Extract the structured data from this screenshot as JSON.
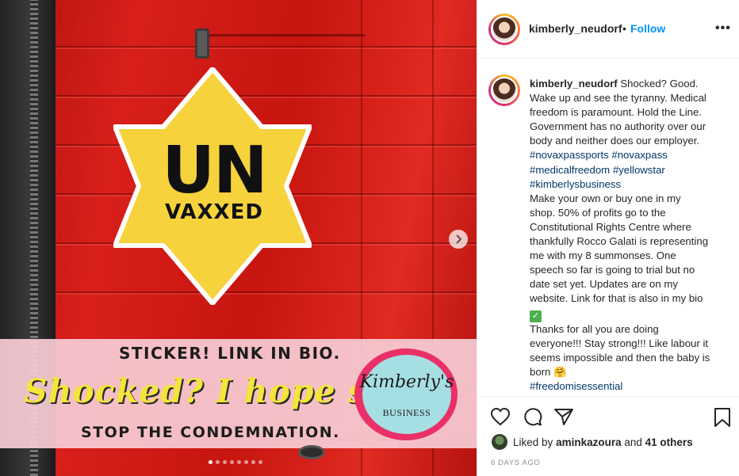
{
  "media": {
    "star_line1": "UN",
    "star_line2": "VAXXED",
    "banner_top": "STICKER!  LINK IN BIO.",
    "banner_script": "Shocked? I hope so.",
    "banner_bottom": "STOP THE CONDEMNATION.",
    "logo_script": "Kimberly's",
    "logo_sub": "BUSINESS",
    "carousel_total": 8,
    "carousel_active": 1,
    "colors": {
      "star": "#f6d33c",
      "banner": "#f7cdd6",
      "jacket": "#d81f1b"
    }
  },
  "header": {
    "username": "kimberly_neudorf",
    "separator": "•",
    "follow_label": "Follow",
    "more_label": "•••"
  },
  "caption": {
    "username": "kimberly_neudorf",
    "lines": [
      "Shocked? Good.",
      "Wake up and see the tyranny. Medical",
      "freedom is paramount. Hold the Line.",
      "Government has no authority over our",
      "body and neither does our employer."
    ],
    "tags_1": [
      "#novaxpassports",
      "#novaxpass"
    ],
    "tags_2": [
      "#medicalfreedom",
      "#yellowstar"
    ],
    "tags_3": [
      "#kimberlysbusiness"
    ],
    "body_lines": [
      "Make your own or buy one in my",
      "shop. 50% of profits go to the",
      "Constitutional Rights Centre where",
      "thankfully Rocco Galati is representing",
      "me with my 8 summonses. One",
      "speech so far is going to trial but no",
      "date set yet. Updates are on my",
      "website. Link for that is also in my bio"
    ],
    "check_glyph": "✓",
    "closing_lines": [
      "Thanks for all you are doing",
      "everyone!!! Stay strong!!! Like labour it",
      "seems impossible and then the baby is"
    ],
    "born_text": "born",
    "born_emoji": "🤗",
    "final_tag": "#freedomisessential"
  },
  "likes": {
    "prefix": "Liked by",
    "user": "aminkazoura",
    "and": "and",
    "others": "41 others"
  },
  "date": "6 DAYS AGO",
  "icons": [
    "heart-icon",
    "comment-icon",
    "share-icon",
    "bookmark-icon",
    "chevron-right-icon"
  ]
}
